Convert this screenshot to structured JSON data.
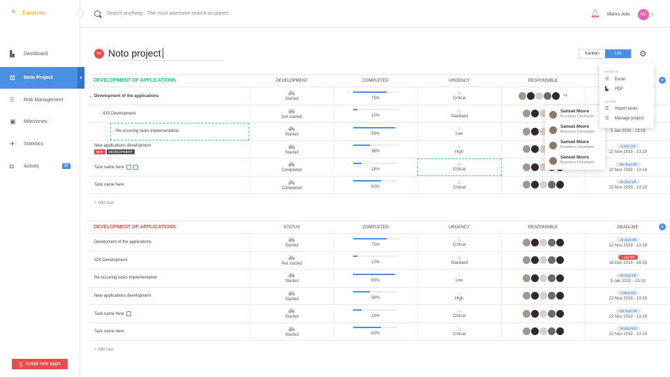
{
  "app": {
    "name": "Easynote"
  },
  "search": {
    "placeholder": "Search anything... The most awesome search on planet!"
  },
  "user": {
    "name": "Marko Jotic",
    "initials": "MJ"
  },
  "sidebar": {
    "items": [
      {
        "label": "Dashboard",
        "icon": "dashboard-icon"
      },
      {
        "label": "Noto Project",
        "icon": "project-icon",
        "active": true
      },
      {
        "label": "Risk Management",
        "icon": "grid-icon"
      },
      {
        "label": "Milestones",
        "icon": "milestone-icon"
      },
      {
        "label": "Statistics",
        "icon": "plane-icon"
      },
      {
        "label": "Activity",
        "icon": "activity-icon",
        "badge": "42"
      }
    ],
    "install_label": "Install new apps"
  },
  "project": {
    "initials": "MJ",
    "title": "Noto project"
  },
  "views": {
    "kanban": "Kanban",
    "list": "List",
    "active": "List"
  },
  "menu": {
    "save_as": "SAVE AS",
    "excel": "Excel",
    "pdf": "PDF",
    "other": "OTHER",
    "import": "Import tasks",
    "manage": "Manage project"
  },
  "people_popup": [
    {
      "name": "Samuel Moore",
      "role": "Business Developer"
    },
    {
      "name": "Samuel Moore",
      "role": "Business Developer"
    },
    {
      "name": "Samuel Moore",
      "role": "Business Developer"
    },
    {
      "name": "Samuel Moore",
      "role": "Business Developer"
    }
  ],
  "table1": {
    "title": "DEVELOPMENT OF APPLICATIONS",
    "title_color": "#1abc9c",
    "headers": {
      "status": "DEVELOPMENT",
      "completed": "COMPLETED",
      "urgency": "URGENCY",
      "responsible": "RESPONSIBLE"
    },
    "rows": [
      {
        "name": "Development of the applications",
        "status": "Started",
        "pct": "75%",
        "pctv": 75,
        "urgency": "Critical",
        "more": "+9"
      },
      {
        "name": "IOS Development",
        "status": "Not started",
        "pct": "10%",
        "pctv": 10,
        "urgency": "Standard"
      },
      {
        "name": "Re-occuring tasks implementation",
        "status": "Started",
        "pct": "93%",
        "pctv": 93,
        "urgency": "Low"
      },
      {
        "name": "New applications development",
        "status": "Started",
        "pct": "38%",
        "pctv": 38,
        "urgency": "High",
        "tag1": "BUG",
        "tag2": "DEVELOPMENT",
        "badge": "3 days left",
        "date": "22 Nov 2019 - 13:19"
      },
      {
        "name": "Task name here",
        "status": "Completed",
        "pct": "18%",
        "pctv": 18,
        "urgency": "Critical",
        "badge": "189 days left",
        "date": "22 Nov 2019 - 13:19"
      },
      {
        "name": "Task name here",
        "status": "Completed",
        "pct": "62%",
        "pctv": 62,
        "urgency": "Critical",
        "badge": "35 days left",
        "date": "22 Nov 2019 - 13:19"
      }
    ],
    "add_task": "+ Add task"
  },
  "table2": {
    "title": "DEVELOPMENT OF APPLICATIONS",
    "title_color": "#e84c4c",
    "headers": {
      "status": "STATUS",
      "completed": "COMPLETED",
      "urgency": "URGENCY",
      "responsible": "RESPONSIBLE",
      "deadline": "DEADLINE"
    },
    "rows": [
      {
        "name": "Develpment of the applications",
        "status": "Started",
        "pct": "75%",
        "pctv": 75,
        "urgency": "Critical",
        "badge": "15 days left",
        "date": "22 Nov 2019 - 13:19"
      },
      {
        "name": "IOS Development",
        "status": "Not started",
        "pct": "10%",
        "pctv": 10,
        "urgency": "Standard",
        "badge": "1 day left",
        "date": "18 Dec 2019 - 18:35"
      },
      {
        "name": "Re-occuring tasks implementation",
        "status": "Started",
        "pct": "93%",
        "pctv": 93,
        "urgency": "Low",
        "badge": "89 days left",
        "date": "5 Jan 2020 - 13:19"
      },
      {
        "name": "New applications development",
        "status": "Started",
        "pct": "38%",
        "pctv": 38,
        "urgency": "High",
        "badge": "3 days left",
        "date": "22 Nov 2019 - 13:19"
      },
      {
        "name": "Task name here",
        "status": "Started",
        "pct": "18%",
        "pctv": 18,
        "urgency": "Critical",
        "badge": "189 days left",
        "date": "22 Nov 2019 - 13:19"
      },
      {
        "name": "Task name here",
        "status": "Started",
        "pct": "62%",
        "pctv": 62,
        "urgency": "Critical",
        "badge": "35 days left",
        "date": "22 Nov 2019 - 13:19"
      }
    ],
    "add_task": "+ Add task"
  },
  "table1_extra": {
    "row1_badge": "",
    "row2_date": "5 Jan 2020 - 13:19"
  },
  "colors": {
    "accent": "#4a90e2",
    "danger": "#e84c4c",
    "teal": "#1abc9c"
  }
}
